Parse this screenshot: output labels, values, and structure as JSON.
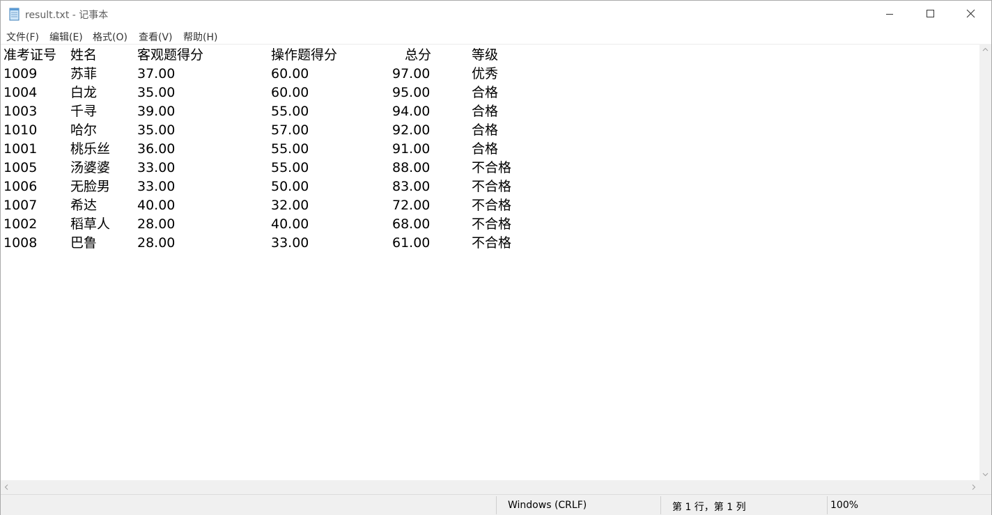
{
  "window": {
    "title": "result.txt - 记事本"
  },
  "menu": [
    "文件(F)",
    "编辑(E)",
    "格式(O)",
    "查看(V)",
    "帮助(H)"
  ],
  "document": {
    "header": [
      "准考证号",
      "姓名",
      "客观题得分",
      "操作题得分",
      "总分",
      "等级"
    ],
    "rows": [
      [
        "1009",
        "苏菲",
        "37.00",
        "60.00",
        "97.00",
        "优秀"
      ],
      [
        "1004",
        "白龙",
        "35.00",
        "60.00",
        "95.00",
        "合格"
      ],
      [
        "1003",
        "千寻",
        "39.00",
        "55.00",
        "94.00",
        "合格"
      ],
      [
        "1010",
        "哈尔",
        "35.00",
        "57.00",
        "92.00",
        "合格"
      ],
      [
        "1001",
        "桃乐丝",
        "36.00",
        "55.00",
        "91.00",
        "合格"
      ],
      [
        "1005",
        "汤婆婆",
        "33.00",
        "55.00",
        "88.00",
        "不合格"
      ],
      [
        "1006",
        "无脸男",
        "33.00",
        "50.00",
        "83.00",
        "不合格"
      ],
      [
        "1007",
        "希达",
        "40.00",
        "32.00",
        "72.00",
        "不合格"
      ],
      [
        "1002",
        "稻草人",
        "28.00",
        "40.00",
        "68.00",
        "不合格"
      ],
      [
        "1008",
        "巴鲁",
        "28.00",
        "33.00",
        "61.00",
        "不合格"
      ]
    ]
  },
  "status": {
    "line_ending": "Windows (CRLF)",
    "position": "第 1 行，第 1 列",
    "zoom": "100%"
  },
  "icons": {
    "app": "notepad-icon",
    "minimize": "minimize-icon",
    "maximize": "maximize-icon",
    "close": "close-icon"
  },
  "colors": {
    "title_text": "#606060",
    "statusbar_bg": "#f0f0f0"
  }
}
